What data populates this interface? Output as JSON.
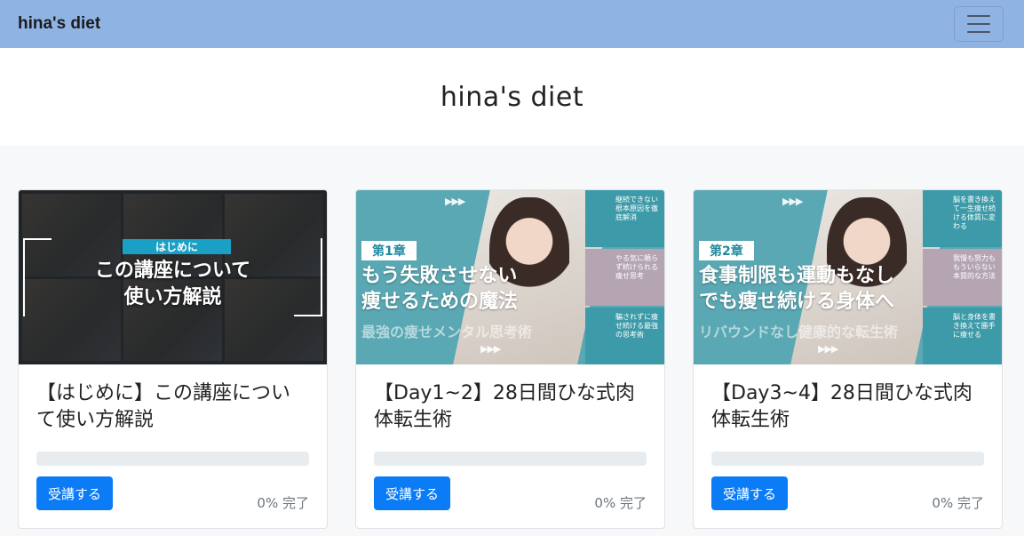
{
  "navbar": {
    "brand": "hina's diet",
    "menu_icon": "hamburger-icon"
  },
  "hero": {
    "title": "hina's diet"
  },
  "colors": {
    "navbar": "#8fb4e3",
    "button": "#0b7cf6",
    "teal": "#5aa8b3"
  },
  "courses": [
    {
      "title": "【はじめに】この講座について使い方解説",
      "button": "受講する",
      "status": "0% 完了",
      "progress": 0,
      "thumbnail": {
        "tag": "はじめに",
        "line1": "この講座について",
        "line2": "使い方解説"
      }
    },
    {
      "title": "【Day1~2】28日間ひな式肉体転生術",
      "button": "受講する",
      "status": "0% 完了",
      "progress": 0,
      "thumbnail": {
        "chapter": "第1章",
        "line1": "もう失敗させない",
        "line2": "痩せるための魔法",
        "sub": "最強の痩せメンタル思考術",
        "side": [
          "継続できない根本原因を徹底解消",
          "やる気に頼らず続けられる痩せ思考",
          "騙されずに痩せ続ける最強の思考術"
        ]
      }
    },
    {
      "title": "【Day3~4】28日間ひな式肉体転生術",
      "button": "受講する",
      "status": "0% 完了",
      "progress": 0,
      "thumbnail": {
        "chapter": "第2章",
        "line1": "食事制限も運動もなし",
        "line2": "でも痩せ続ける身体へ",
        "sub": "リバウンドなし健康的な転生術",
        "side": [
          "脳を書き換えて一生痩せ続ける体質に変わる",
          "我慢も努力ももういらない本質的な方法",
          "脳と身体を書き換えて勝手に痩せる"
        ]
      }
    }
  ]
}
